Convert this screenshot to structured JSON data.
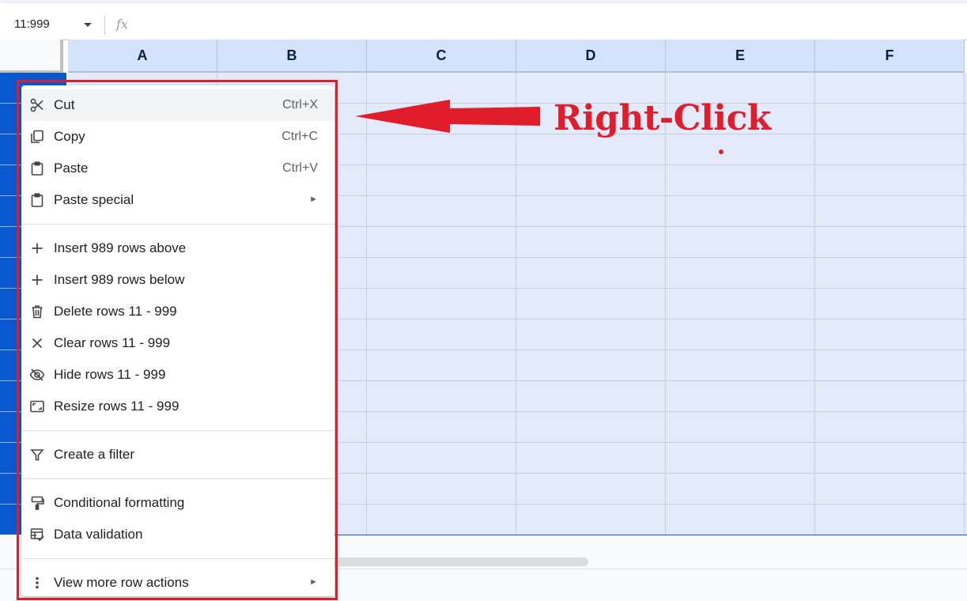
{
  "formula_bar": {
    "name_box": "11:999",
    "fx_label": "fx"
  },
  "columns": [
    "A",
    "B",
    "C",
    "D",
    "E",
    "F"
  ],
  "context_menu": {
    "items": [
      {
        "label": "Cut",
        "shortcut": "Ctrl+X",
        "icon": "cut-icon"
      },
      {
        "label": "Copy",
        "shortcut": "Ctrl+C",
        "icon": "copy-icon"
      },
      {
        "label": "Paste",
        "shortcut": "Ctrl+V",
        "icon": "paste-icon"
      },
      {
        "label": "Paste special",
        "submenu_arrow": "►",
        "icon": "paste-icon"
      },
      {
        "label": "Insert 989 rows above",
        "icon": "plus-icon"
      },
      {
        "label": "Insert 989 rows below",
        "icon": "plus-icon"
      },
      {
        "label": "Delete rows 11 - 999",
        "icon": "trash-icon"
      },
      {
        "label": "Clear rows 11 - 999",
        "icon": "close-icon"
      },
      {
        "label": "Hide rows 11 - 999",
        "icon": "eye-off-icon"
      },
      {
        "label": "Resize rows 11 - 999",
        "icon": "resize-icon"
      },
      {
        "label": "Create a filter",
        "icon": "filter-icon"
      },
      {
        "label": "Conditional formatting",
        "icon": "paint-roller-icon"
      },
      {
        "label": "Data validation",
        "icon": "data-validation-icon"
      },
      {
        "label": "View more row actions",
        "submenu_arrow": "►",
        "icon": "more-vert-icon"
      }
    ]
  },
  "annotation": {
    "text": "Right-Click",
    "color": "#e11d2c"
  },
  "colors": {
    "selection_row_header": "#0b57d0",
    "column_header_bg": "#d3e3fd",
    "selected_cell_bg": "#e3ebfb",
    "menu_hover": "#f1f3f4"
  }
}
